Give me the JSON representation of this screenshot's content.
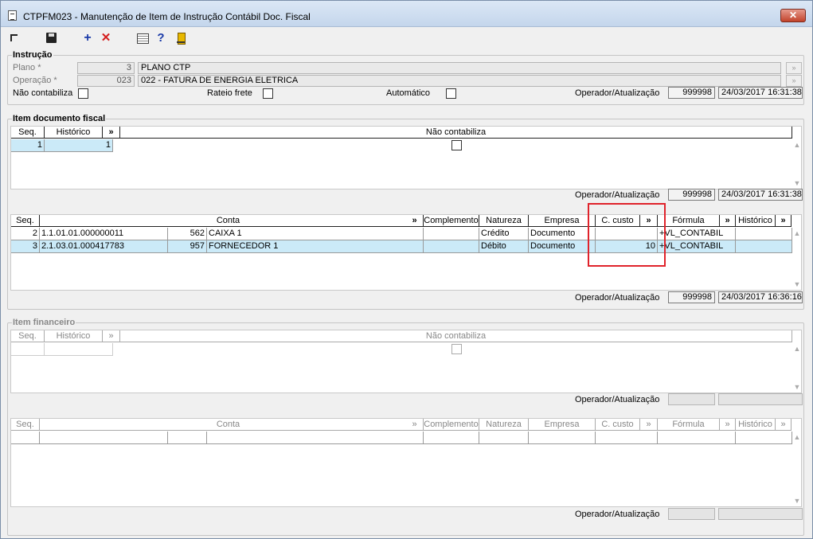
{
  "window": {
    "title": "CTPFM023 - Manutenção de Item de Instrução Contábil Doc. Fiscal",
    "close_label": "✕"
  },
  "toolbar": {
    "icons": [
      "nav-arrow-icon",
      "save-icon",
      "add-icon",
      "delete-icon",
      "grid-icon",
      "help-icon",
      "exit-door-icon"
    ],
    "add_glyph": "+",
    "delete_glyph": "✕",
    "help_glyph": "?"
  },
  "instrucao": {
    "group_title": "Instrução",
    "plano_label": "Plano *",
    "plano_code": "3",
    "plano_desc": "PLANO CTP",
    "operacao_label": "Operação *",
    "operacao_code": "023",
    "operacao_desc": "022 - FATURA DE ENERGIA ELETRICA",
    "nao_contabiliza_label": "Não contabiliza",
    "rateio_frete_label": "Rateio frete",
    "automatico_label": "Automático",
    "operador_label": "Operador/Atualização",
    "operador": "999998",
    "atualizacao": "24/03/2017 16:31:38",
    "lookup_glyph": "»"
  },
  "item_doc_fiscal": {
    "group_title": "Item documento fiscal",
    "headers": {
      "seq": "Seq.",
      "historico": "Histórico",
      "more": "»",
      "nao_contabiliza": "Não contabiliza"
    },
    "rows": [
      {
        "seq": "1",
        "historico": "1"
      }
    ],
    "operador_label": "Operador/Atualização",
    "operador": "999998",
    "atualizacao": "24/03/2017 16:31:38"
  },
  "contas": {
    "headers": {
      "seq": "Seq.",
      "conta": "Conta",
      "more1": "»",
      "complemento": "Complemento",
      "natureza": "Natureza",
      "empresa": "Empresa",
      "c_custo": "C. custo",
      "more2": "»",
      "formula": "Fórmula",
      "more3": "»",
      "historico": "Histórico",
      "more4": "»"
    },
    "rows": [
      {
        "seq": "2",
        "conta": "1.1.01.01.000000011",
        "codigo": "562",
        "descricao": "CAIXA 1",
        "complemento": "",
        "natureza": "Crédito",
        "empresa": "Documento",
        "c_custo": "",
        "formula": "+VL_CONTABIL",
        "historico": ""
      },
      {
        "seq": "3",
        "conta": "2.1.03.01.000417783",
        "codigo": "957",
        "descricao": "FORNECEDOR 1",
        "complemento": "",
        "natureza": "Débito",
        "empresa": "Documento",
        "c_custo": "10",
        "formula": "+VL_CONTABIL",
        "historico": ""
      }
    ],
    "operador_label": "Operador/Atualização",
    "operador": "999998",
    "atualizacao": "24/03/2017 16:36:16"
  },
  "item_financeiro": {
    "group_title": "Item financeiro",
    "headers": {
      "seq": "Seq.",
      "historico": "Histórico",
      "more": "»",
      "nao_contabiliza": "Não contabiliza"
    },
    "operador_label": "Operador/Atualização"
  },
  "contas_financeiro": {
    "headers": {
      "seq": "Seq.",
      "conta": "Conta",
      "more1": "»",
      "complemento": "Complemento",
      "natureza": "Natureza",
      "empresa": "Empresa",
      "c_custo": "C. custo",
      "more2": "»",
      "formula": "Fórmula",
      "more3": "»",
      "historico": "Histórico",
      "more4": "»"
    },
    "operador_label": "Operador/Atualização"
  },
  "colors": {
    "selected_row": "#cbeaf8",
    "highlight_box": "#e0232b",
    "close_button": "#c2432b"
  }
}
